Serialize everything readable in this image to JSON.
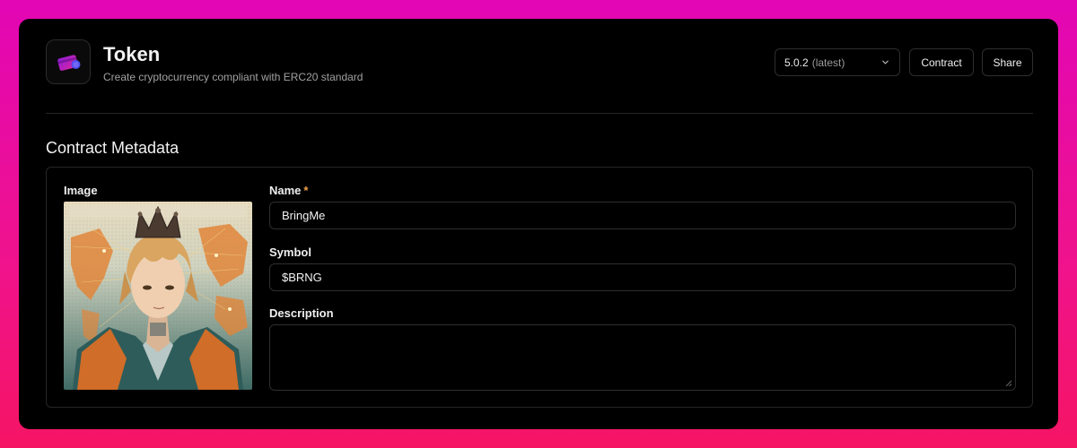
{
  "header": {
    "title": "Token",
    "subtitle": "Create cryptocurrency compliant with ERC20 standard",
    "logo_icon": "token-card-icon",
    "version": {
      "value": "5.0.2",
      "tag": "(latest)"
    },
    "buttons": {
      "contract": "Contract",
      "share": "Share"
    }
  },
  "section": {
    "title": "Contract Metadata"
  },
  "form": {
    "image_label": "Image",
    "name": {
      "label": "Name",
      "required_mark": "*",
      "value": "BringMe"
    },
    "symbol": {
      "label": "Symbol",
      "value": "$BRNG"
    },
    "description": {
      "label": "Description",
      "value": ""
    }
  },
  "colors": {
    "background_gradient": [
      "#e206b5",
      "#f51464"
    ],
    "panel": "#000000",
    "border": "#2e2e2e",
    "required": "#f2a14a",
    "logo_accent": "#b01eea"
  }
}
